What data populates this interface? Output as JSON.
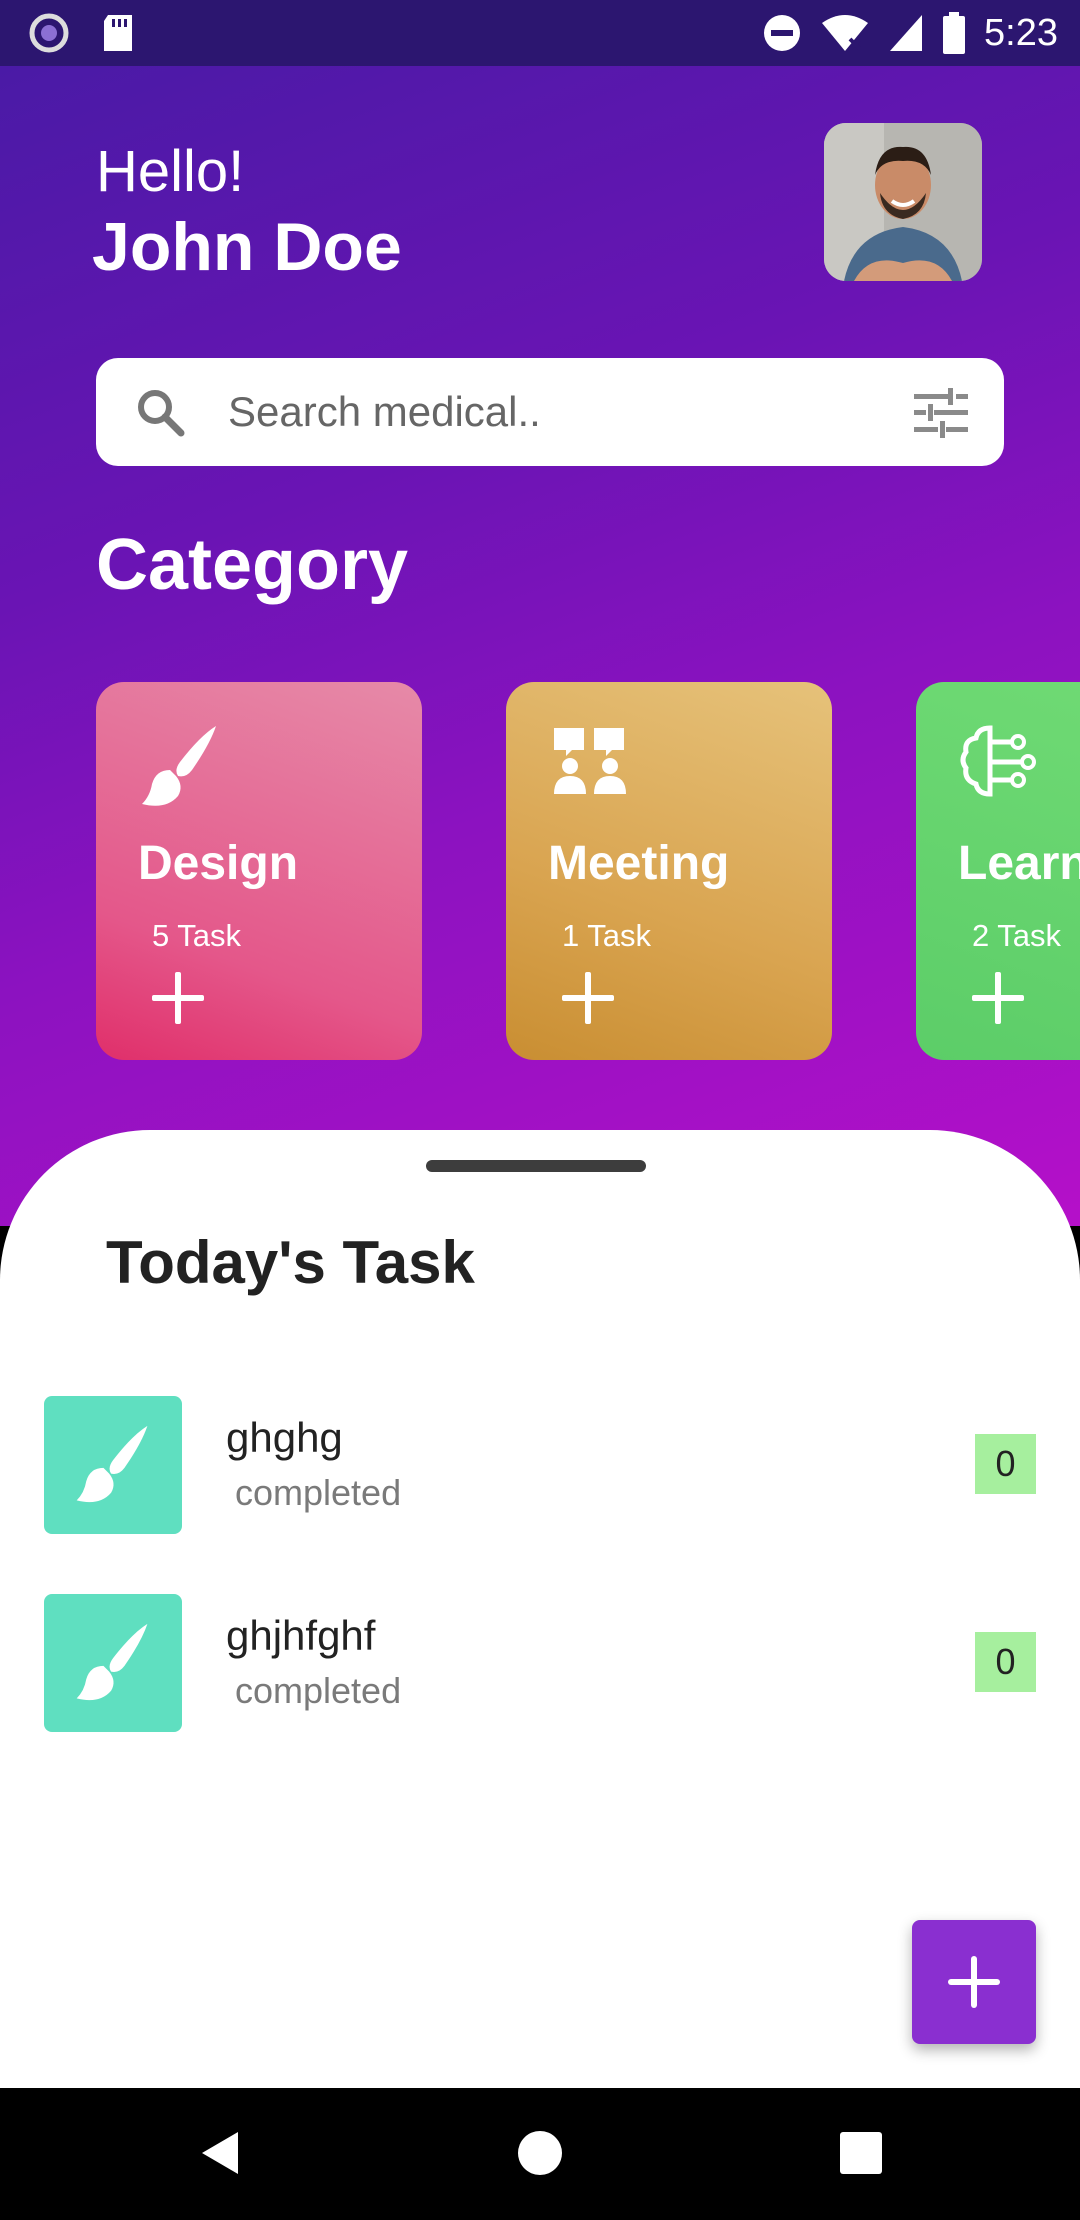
{
  "status_bar": {
    "time": "5:23"
  },
  "header": {
    "greeting": "Hello!",
    "user_name": "John Doe"
  },
  "search": {
    "placeholder": "Search medical.."
  },
  "category": {
    "title": "Category",
    "cards": [
      {
        "name": "Design",
        "count": "5 Task",
        "icon": "brush-icon",
        "color": "#e4578a"
      },
      {
        "name": "Meeting",
        "count": "1 Task",
        "icon": "meeting-icon",
        "color": "#d9a450"
      },
      {
        "name": "Learn",
        "count": "2 Task",
        "icon": "brain-icon",
        "color": "#5ccd68"
      }
    ]
  },
  "tasks": {
    "title": "Today's Task",
    "items": [
      {
        "name": "ghghg",
        "status": "completed",
        "badge": "0",
        "icon": "brush-icon"
      },
      {
        "name": "ghjhfghf",
        "status": "completed",
        "badge": "0",
        "icon": "brush-icon"
      }
    ]
  },
  "colors": {
    "accent": "#8a2fd0",
    "task_icon_bg": "#5fdfc0",
    "badge_bg": "#a6ef9e"
  }
}
